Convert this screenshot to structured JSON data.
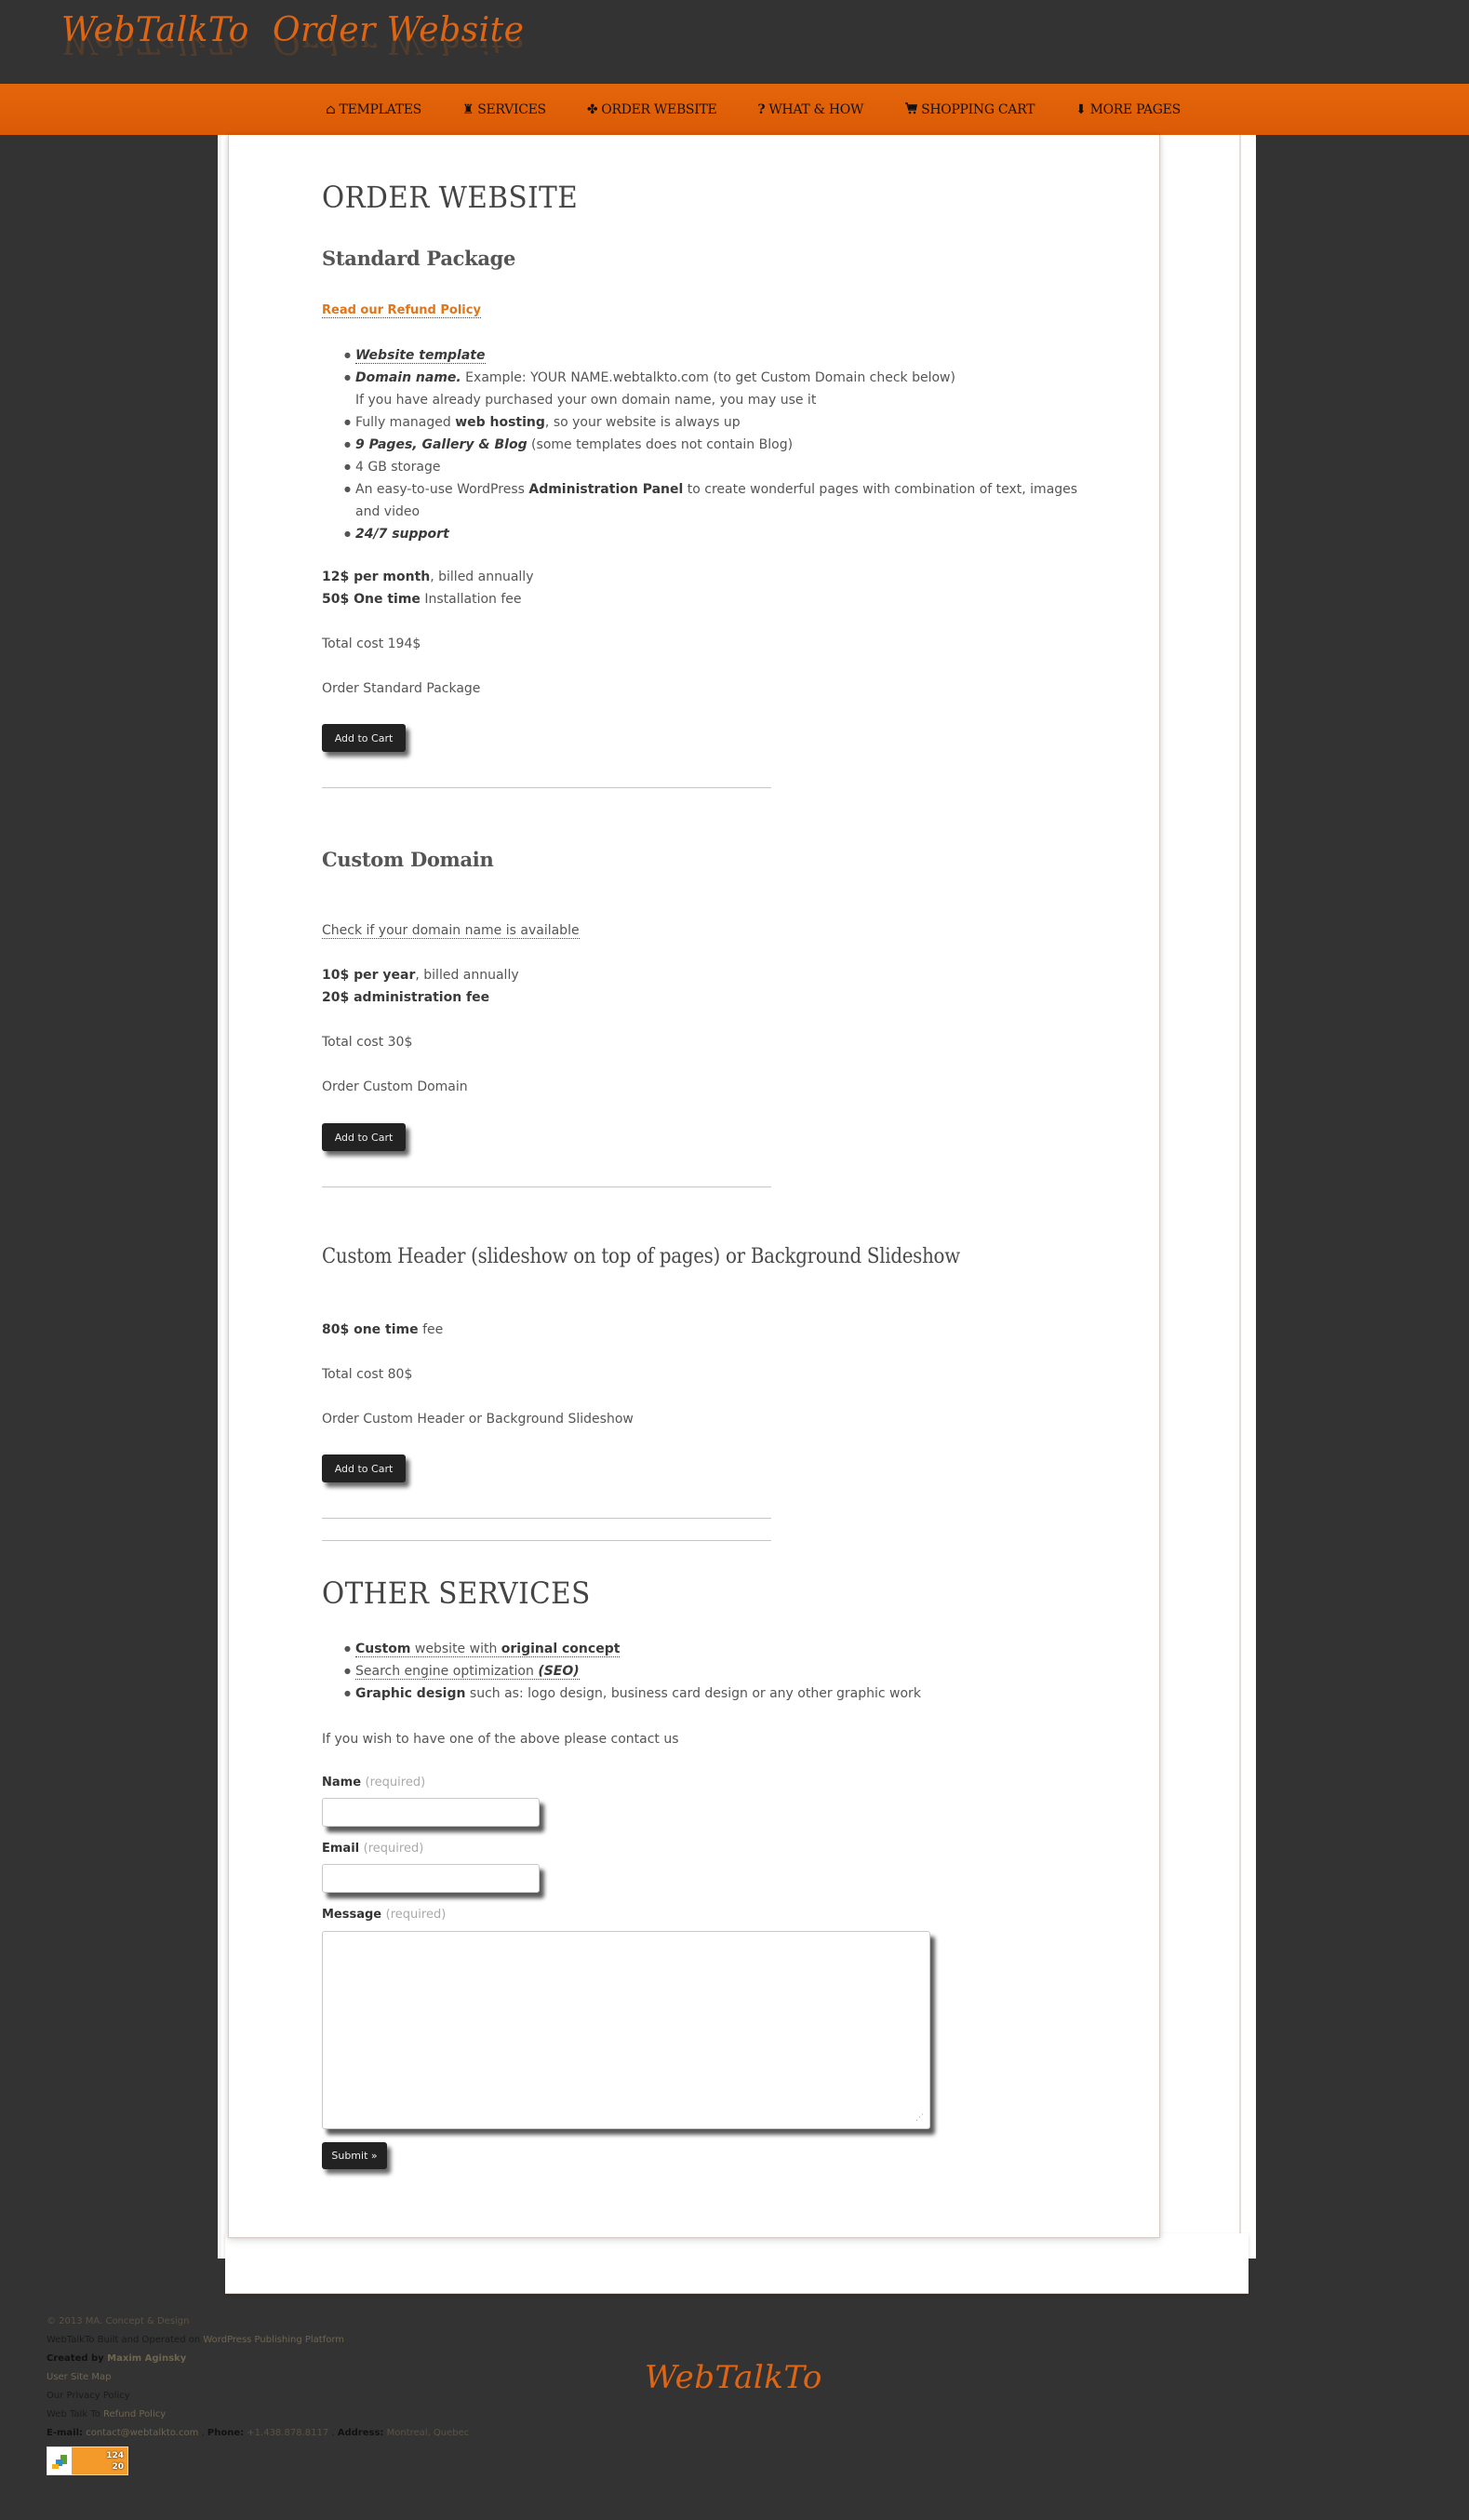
{
  "header": {
    "logo": "WebTalkTo",
    "page_name": "Order Website"
  },
  "nav": {
    "items": [
      {
        "label": "Templates",
        "icon": "house-icon",
        "glyph": "⌂"
      },
      {
        "label": "Services",
        "icon": "tower-icon",
        "glyph": "♜"
      },
      {
        "label": "Order Website",
        "icon": "maple-leaf-icon",
        "glyph": "✤"
      },
      {
        "label": "What & How",
        "icon": "question-icon",
        "glyph": "?"
      },
      {
        "label": "Shopping Cart",
        "icon": "cart-icon",
        "glyph": "🛒"
      },
      {
        "label": "More Pages",
        "icon": "arrow-down-icon",
        "glyph": "⬇"
      }
    ]
  },
  "main": {
    "title": "Order Website",
    "standard": {
      "title": "Standard Package",
      "refund_link": "Read our Refund Policy",
      "features": [
        {
          "bold_italic": "Website template",
          "rest": ""
        },
        {
          "bold_italic": "Domain name.",
          "rest": " Example: YOUR NAME.webtalkto.com (to get Custom Domain check below)"
        },
        {
          "continuation": "If you have already purchased your own domain name, you may use it"
        },
        {
          "pre": "Fully managed ",
          "bold": "web hosting",
          "post": ", so your website is always up"
        },
        {
          "bold_italic": "9  Pages, Gallery & Blog",
          "rest": " (some templates does not contain Blog)"
        },
        {
          "text": "4 GB storage"
        },
        {
          "pre": "An easy-to-use WordPress ",
          "bold": "Administration Panel",
          "post": " to create wonderful pages with combination of text, images"
        },
        {
          "continuation": "and video"
        },
        {
          "bold_italic": "24/7 support",
          "rest": ""
        }
      ],
      "price_line1_bold": "12$ per month",
      "price_line1_rest": ", billed annually",
      "price_line2_bold": "50$ One time",
      "price_line2_rest": " Installation fee",
      "total": "Total cost 194$",
      "order_label": "Order Standard Package",
      "button": "Add to Cart"
    },
    "domain": {
      "title": "Custom Domain",
      "check_link": "Check if your domain name is available",
      "price_line1_bold": "10$ per year",
      "price_line1_rest": ", billed annually",
      "price_line2_bold": "20$ administration fee",
      "total": "Total cost 30$",
      "order_label": "Order Custom Domain",
      "button": "Add to Cart"
    },
    "header_slideshow": {
      "title": "Custom Header (slideshow on top of pages) or Background Slideshow",
      "price_bold": "80$ one time",
      "price_rest": " fee",
      "total": "Total cost 80$",
      "order_label": "Order Custom Header or Background Slideshow",
      "button": "Add to Cart"
    },
    "other": {
      "title": "Other Services",
      "items": [
        {
          "b1": "Custom",
          "mid": " website with ",
          "b2": "original concept"
        },
        {
          "pre": "Search engine optimization ",
          "bi": "(SEO)"
        },
        {
          "b1": "Graphic design",
          "mid": " such as: logo design, business card design or any other graphic work"
        }
      ],
      "contact_text": "If you wish to have one of the above please contact us"
    },
    "form": {
      "name_label": "Name",
      "email_label": "Email",
      "message_label": "Message",
      "required": "(required)",
      "name_value": "",
      "email_value": "",
      "message_value": "",
      "submit": "Submit »"
    }
  },
  "footer": {
    "copyright": "© 2013 MA. Concept & Design",
    "built_pre": "WebTalkTo Built and Operated on ",
    "built_link": "WordPress Publishing Platform",
    "created_pre": "Created by ",
    "created_link": "Maxim Aginsky",
    "sitemap": "User Site Map",
    "privacy": "Our Privacy Policy",
    "refund_pre": "Web Talk To ",
    "refund_link": "Refund Policy",
    "email_label": "E-mail:",
    "email": "contact@webtalkto.com",
    "phone_label": "Phone:",
    "phone": "+1.438.878.8117",
    "address_label": "Address:",
    "address": "Montreal, Quebec",
    "counter_top": "124",
    "counter_bottom": "20",
    "logo": "WebTalkTo"
  }
}
